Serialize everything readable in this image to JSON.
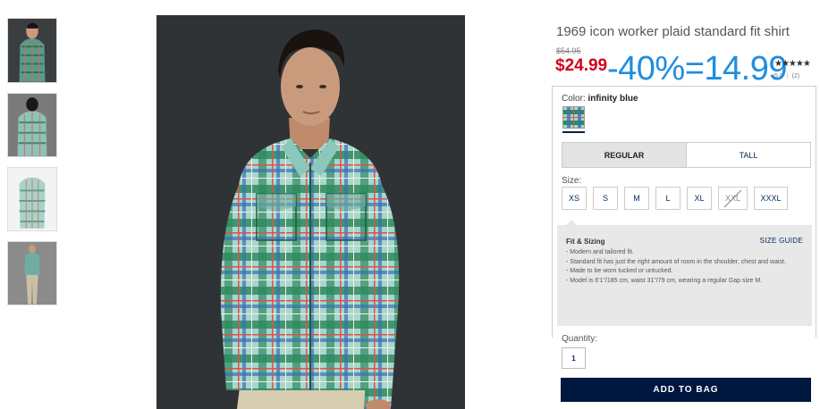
{
  "product": {
    "title": "1969 icon worker plaid standard fit shirt",
    "original_price": "$54.95",
    "sale_price": "$24.99",
    "discount_overlay": "-40%=14.99",
    "rating_stars": "★★★★★",
    "rating_value": "5.0",
    "review_count": "(2)"
  },
  "color": {
    "label": "Color:",
    "selected_name": "infinity blue"
  },
  "fit_tabs": [
    {
      "label": "REGULAR",
      "active": true
    },
    {
      "label": "TALL",
      "active": false
    }
  ],
  "size": {
    "label": "Size:",
    "options": [
      {
        "label": "XS",
        "available": true
      },
      {
        "label": "S",
        "available": true
      },
      {
        "label": "M",
        "available": true
      },
      {
        "label": "L",
        "available": true
      },
      {
        "label": "XL",
        "available": true
      },
      {
        "label": "XXL",
        "available": false
      },
      {
        "label": "XXXL",
        "available": true
      }
    ]
  },
  "fit_sizing": {
    "title": "Fit & Sizing",
    "size_guide_label": "SIZE GUIDE",
    "bullets": [
      "- Modern and tailored fit.",
      "- Standard fit has just the right amount of room in the shoulder, chest and waist.",
      "- Made to be worn tucked or untucked.",
      "- Model is 6'1\"/185 cm, waist 31\"/79 cm, wearing a regular Gap size M."
    ]
  },
  "quantity": {
    "label": "Quantity:",
    "value": "1"
  },
  "add_to_bag_label": "ADD TO BAG",
  "colors": {
    "sale_red": "#d0021b",
    "discount_blue": "#1f8de0",
    "navy": "#00173f"
  }
}
